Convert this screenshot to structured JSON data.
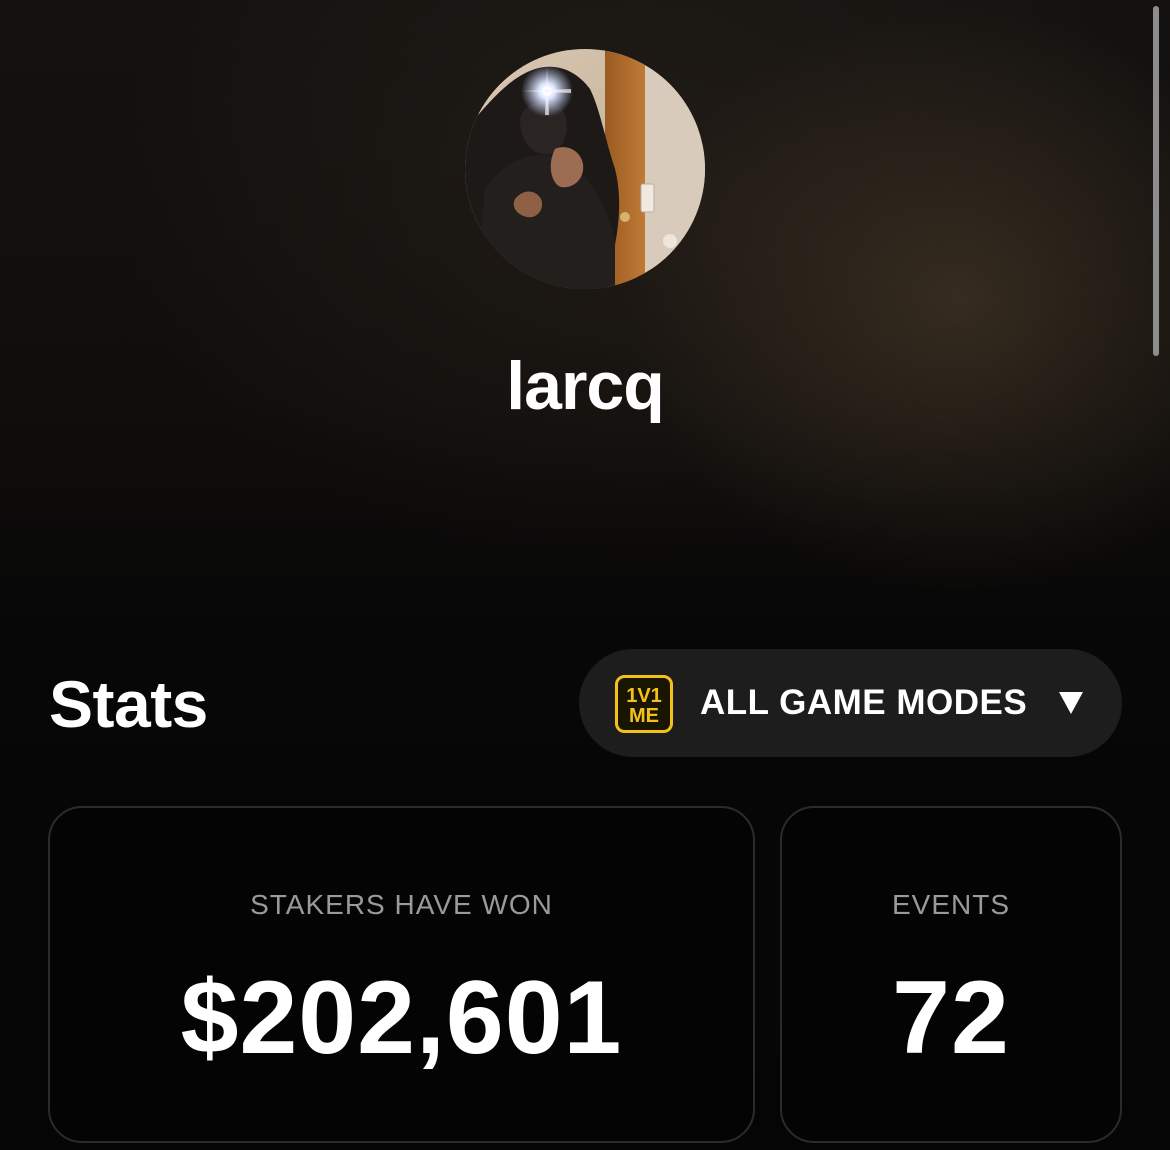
{
  "profile": {
    "username": "larcq",
    "avatar_icon": "profile-photo"
  },
  "stats": {
    "title": "Stats",
    "mode_selector": {
      "label": "ALL GAME MODES",
      "logo_text_top": "1V1",
      "logo_text_bottom": "ME",
      "logo_color": "#f2c21b",
      "caret_icon": "caret-down-icon"
    },
    "cards": [
      {
        "label": "STAKERS HAVE WON",
        "value": "$202,601"
      },
      {
        "label": "EVENTS",
        "value": "72"
      }
    ]
  }
}
